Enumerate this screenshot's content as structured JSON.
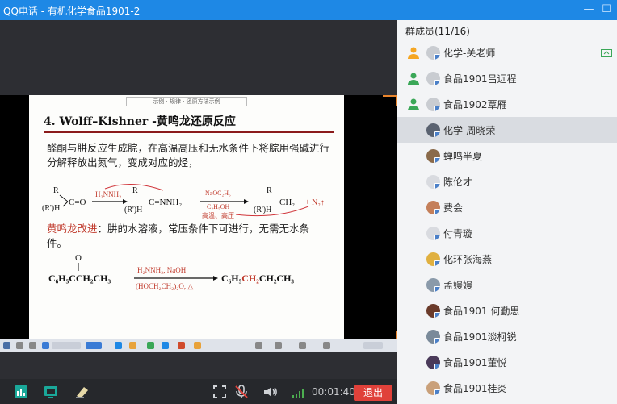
{
  "window": {
    "title": "QQ电话 - 有机化学食品1901-2",
    "controls": [
      "minimize-icon",
      "maximize-icon"
    ]
  },
  "slide": {
    "header_strip": "示例 · 规律 · 还原方法示例",
    "heading_prefix": "4. Wolff–Kishner -",
    "heading_cn": "黄鸣龙还原反应",
    "para1": "醛酮与肼反应生成腙，在高温高压和无水条件下将腙用强碱进行分解释放出氮气，变成对应的烃，",
    "reaction1": {
      "reactant_r": "R",
      "reactant_rh": "(R')H",
      "reagent1": "H₂NNH₂",
      "product_mid": "C=NNH₂",
      "reagent2_top": "NaOC₂H₅",
      "reagent2_bottom": "C₂H₅OH",
      "condition": "高温、高压",
      "product_end": "CH₂",
      "byproduct": "+ N₂↑"
    },
    "para2_red": "黄鸣龙改进",
    "para2_rest": "：肼的水溶液，常压条件下可进行，无需无水条件。",
    "reaction2": {
      "oxygen": "O",
      "reactant": "C₆H₅CCH₂CH₃",
      "reagent_top": "H₂NNH₂, NaOH",
      "reagent_bottom": "(HOCH₂CH₂)₂O, △",
      "product_pre": "C₆H₅",
      "product_red": "CH₂",
      "product_post": "CH₂CH₃"
    }
  },
  "toolbar": {
    "timer": "00:01:40",
    "exit_label": "退出",
    "tools": [
      "chart-icon",
      "screen-share-icon",
      "whiteboard-icon",
      "fullscreen-icon",
      "microphone-muted-icon",
      "speaker-icon",
      "signal-icon"
    ]
  },
  "members": {
    "header": "群成员(11/16)",
    "list": [
      {
        "name": "化学-关老师",
        "role": "admin-orange"
      },
      {
        "name": "食品1901吕远程",
        "role": "admin-green"
      },
      {
        "name": "食品1902覃雁",
        "role": "admin-green"
      },
      {
        "name": "化学-周晓荣",
        "role": "none"
      },
      {
        "name": "蝉鸣半夏",
        "role": "none"
      },
      {
        "name": "陈伦才",
        "role": "none"
      },
      {
        "name": "费会",
        "role": "none"
      },
      {
        "name": "付青璇",
        "role": "none"
      },
      {
        "name": "化环张海燕",
        "role": "none"
      },
      {
        "name": "孟嫚嫚",
        "role": "none"
      },
      {
        "name": "食品1901  何勤思",
        "role": "none"
      },
      {
        "name": "食品1901淡柯锐",
        "role": "none"
      },
      {
        "name": "食品1901董悦",
        "role": "none"
      },
      {
        "name": "食品1901桂炎",
        "role": "none"
      }
    ],
    "active_index": 3
  },
  "colors": {
    "titlebar": "#1e88e5",
    "exit": "#e0413a",
    "accent_red": "#c0392b",
    "admin_orange": "#f5a623",
    "admin_green": "#3aa757"
  }
}
